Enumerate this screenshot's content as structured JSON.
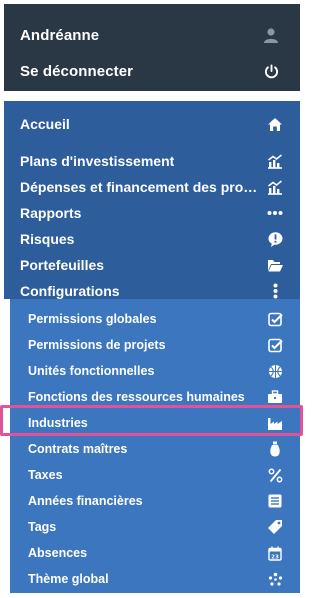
{
  "user": {
    "name": "Andréanne",
    "logout_label": "Se déconnecter",
    "user_icon": "user-icon",
    "power_icon": "power-icon"
  },
  "nav": {
    "items": [
      {
        "label": "Accueil",
        "icon": "home-icon"
      },
      {
        "label": "Plans d'investissement",
        "icon": "chart-icon"
      },
      {
        "label": "Dépenses et financement des pro…",
        "icon": "chart-icon"
      },
      {
        "label": "Rapports",
        "icon": "ellipsis-icon"
      },
      {
        "label": "Risques",
        "icon": "alert-icon"
      },
      {
        "label": "Portefeuilles",
        "icon": "folder-open-icon"
      },
      {
        "label": "Configurations",
        "icon": "vertical-ellipsis-icon"
      }
    ],
    "sub_items": [
      {
        "label": "Permissions globales",
        "icon": "check-square-icon"
      },
      {
        "label": "Permissions de projets",
        "icon": "check-square-icon"
      },
      {
        "label": "Unités fonctionnelles",
        "icon": "basketball-icon"
      },
      {
        "label": "Fonctions des ressources humaines",
        "icon": "briefcase-icon"
      },
      {
        "label": "Industries",
        "icon": "industry-icon"
      },
      {
        "label": "Contrats maîtres",
        "icon": "bottle-icon"
      },
      {
        "label": "Taxes",
        "icon": "percent-icon"
      },
      {
        "label": "Années financières",
        "icon": "list-icon"
      },
      {
        "label": "Tags",
        "icon": "tag-icon"
      },
      {
        "label": "Absences",
        "icon": "calendar-icon"
      },
      {
        "label": "Thème global",
        "icon": "pinwheel-icon"
      }
    ],
    "calendar_day": "23"
  },
  "colors": {
    "user_bg": "#2a3846",
    "nav_bg": "#2d5d9b",
    "sub_bg": "#3b76bf",
    "highlight": "#e0539a"
  }
}
